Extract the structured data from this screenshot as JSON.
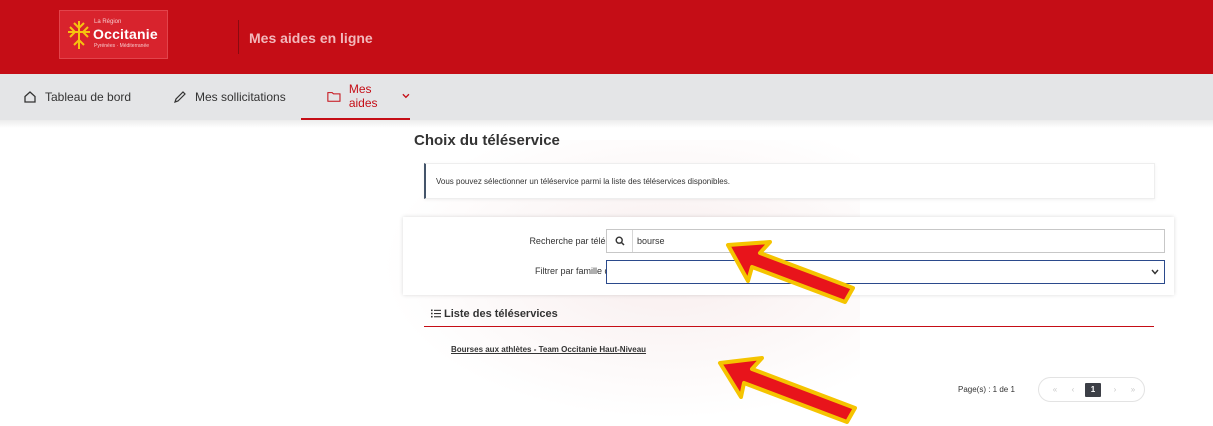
{
  "header": {
    "logo_small": "La Région",
    "logo_big": "Occitanie",
    "logo_sub": "Pyrénées · Méditerranée",
    "app_title": "Mes aides en ligne"
  },
  "nav": {
    "items": [
      {
        "label": "Tableau de bord",
        "icon": "home-icon"
      },
      {
        "label": "Mes sollicitations",
        "icon": "pen-icon"
      },
      {
        "label": "Mes aides",
        "icon": "folder-icon",
        "active": true
      }
    ]
  },
  "main": {
    "title": "Choix du téléservice",
    "info": "Vous pouvez sélectionner un téléservice parmi la liste des téléservices disponibles.",
    "search": {
      "label": "Recherche par téléservice",
      "value": "bourse"
    },
    "filter": {
      "label": "Filtrer par famille de tiers",
      "value": ""
    },
    "list": {
      "title": "Liste des téléservices",
      "results": [
        "Bourses aux athlètes - Team Occitanie Haut-Niveau"
      ]
    },
    "pagination": {
      "label": "Page(s) : 1 de 1",
      "first": "«",
      "prev": "‹",
      "current": "1",
      "next": "›",
      "last": "»"
    }
  },
  "colors": {
    "brand_red": "#c50d16",
    "nav_bg": "#e4e5e7",
    "annotation_arrow": "#e8141b",
    "annotation_outline": "#f5c400"
  }
}
